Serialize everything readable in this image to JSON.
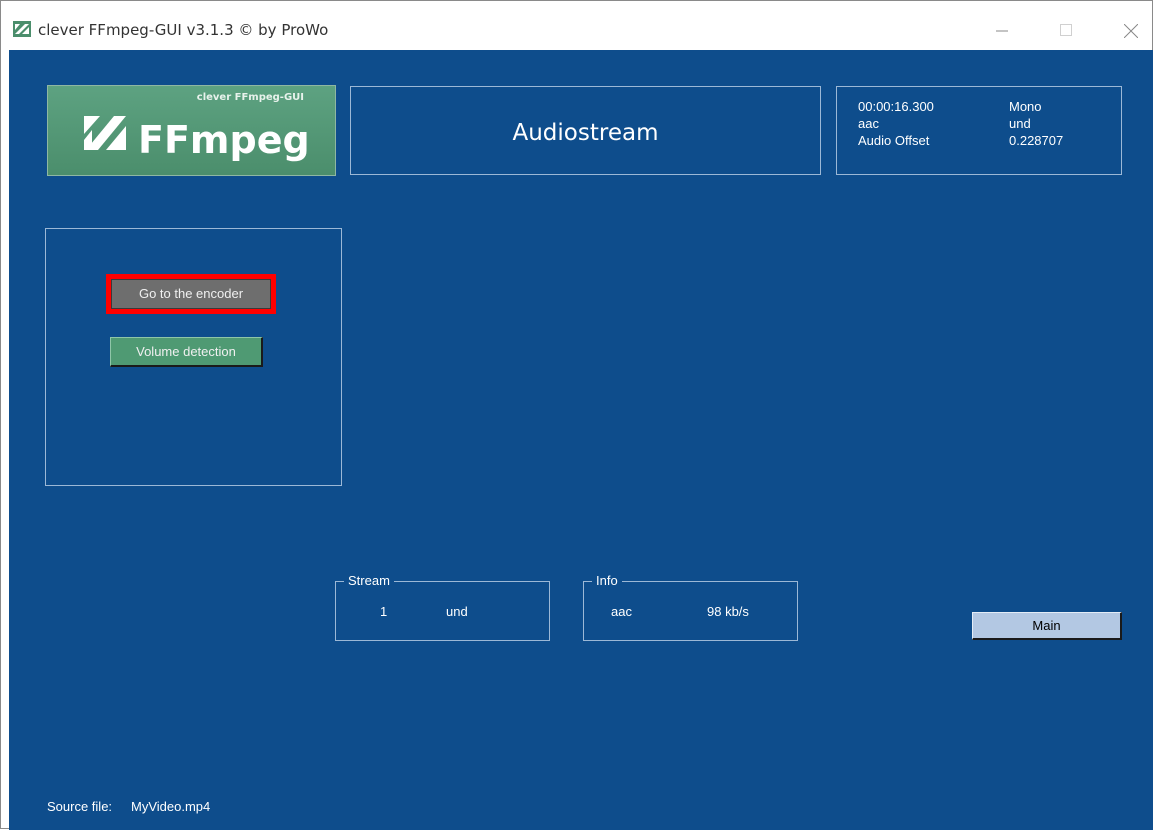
{
  "window": {
    "title": "clever FFmpeg-GUI v3.1.3   © by ProWo",
    "icon": "ffmpeg-logo-icon",
    "controls": {
      "minimize": "minimize-icon",
      "maximize": "maximize-icon",
      "close": "close-icon"
    }
  },
  "colors": {
    "background": "#0e4d8c",
    "logo_green": "#5da281",
    "encoder_button": "#6e6e6e",
    "volume_button": "#4f9a73",
    "main_button": "#b3c8e3",
    "highlight": "#ff0000"
  },
  "logo": {
    "small_text": "clever FFmpeg-GUI",
    "big_text": "FFmpeg"
  },
  "header": {
    "title": "Audiostream"
  },
  "stream_info": {
    "duration": "00:00:16.300",
    "channels": "Mono",
    "codec": "aac",
    "language": "und",
    "offset_label": "Audio Offset",
    "offset_value": "0.228707"
  },
  "actions": {
    "encoder_label": "Go to the encoder",
    "volume_label": "Volume detection",
    "main_label": "Main"
  },
  "stream_group": {
    "legend": "Stream",
    "index": "1",
    "language": "und"
  },
  "info_group": {
    "legend": "Info",
    "codec": "aac",
    "bitrate": "98 kb/s"
  },
  "footer": {
    "source_label": "Source file:",
    "source_value": "MyVideo.mp4"
  }
}
